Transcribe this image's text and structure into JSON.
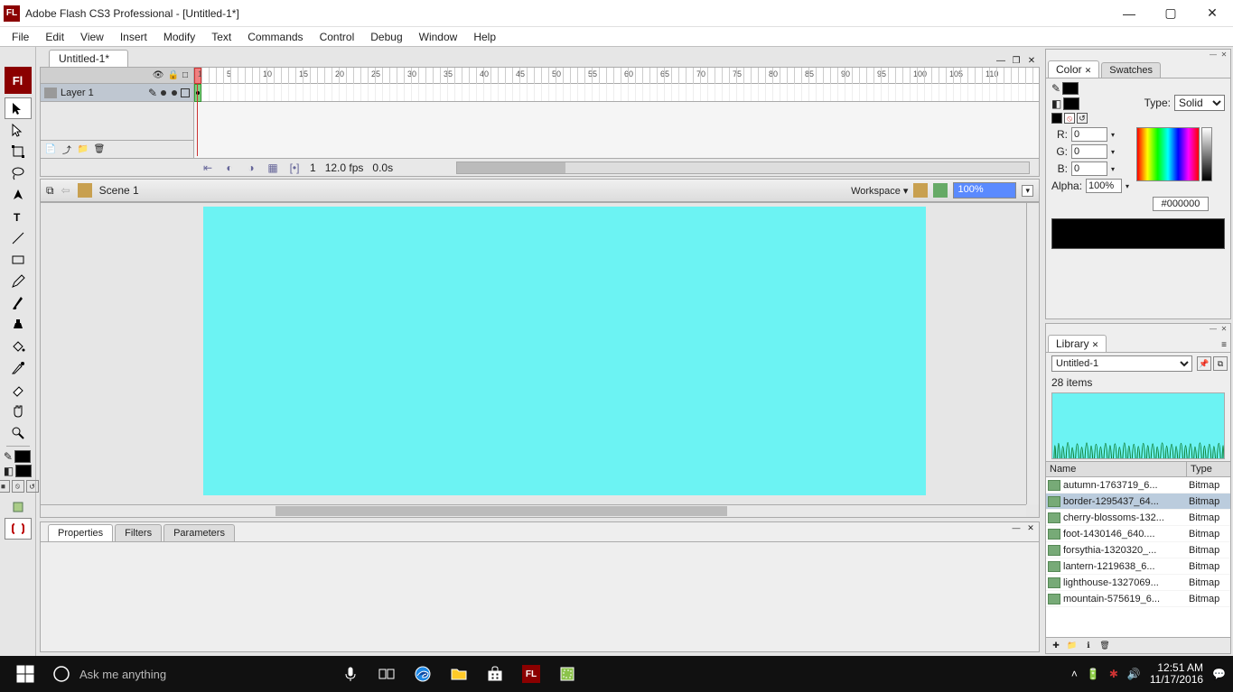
{
  "titlebar": {
    "app_icon_text": "FL",
    "title": "Adobe Flash CS3 Professional - [Untitled-1*]"
  },
  "menu": {
    "items": [
      "File",
      "Edit",
      "View",
      "Insert",
      "Modify",
      "Text",
      "Commands",
      "Control",
      "Debug",
      "Window",
      "Help"
    ]
  },
  "tools": {
    "logo": "Fl"
  },
  "document": {
    "tab": "Untitled-1*"
  },
  "timeline": {
    "layer": "Layer 1",
    "ruler": [
      1,
      5,
      10,
      15,
      20,
      25,
      30,
      35,
      40,
      45,
      50,
      55,
      60,
      65,
      70,
      75,
      80,
      85,
      90,
      95,
      100,
      105,
      110
    ],
    "status": {
      "frame": "1",
      "fps": "12.0 fps",
      "time": "0.0s"
    }
  },
  "scenebar": {
    "scene": "Scene 1",
    "workspace_label": "Workspace ▾",
    "zoom": "100%"
  },
  "bottom_panel": {
    "tabs": [
      "Properties",
      "Filters",
      "Parameters"
    ],
    "active": 0
  },
  "color_panel": {
    "tabs": [
      "Color",
      "Swatches"
    ],
    "active": 0,
    "type_label": "Type:",
    "type_value": "Solid",
    "r_label": "R:",
    "r": "0",
    "g_label": "G:",
    "g": "0",
    "b_label": "B:",
    "b": "0",
    "alpha_label": "Alpha:",
    "alpha": "100%",
    "hex": "#000000"
  },
  "library_panel": {
    "tab": "Library",
    "doc": "Untitled-1",
    "count": "28 items",
    "columns": {
      "name": "Name",
      "type": "Type"
    },
    "type_value": "Bitmap",
    "items": [
      "autumn-1763719_6...",
      "border-1295437_64...",
      "cherry-blossoms-132...",
      "foot-1430146_640....",
      "forsythia-1320320_...",
      "lantern-1219638_6...",
      "lighthouse-1327069...",
      "mountain-575619_6..."
    ],
    "selected": 1
  },
  "taskbar": {
    "search_placeholder": "Ask me anything",
    "time": "12:51 AM",
    "date": "11/17/2016"
  }
}
